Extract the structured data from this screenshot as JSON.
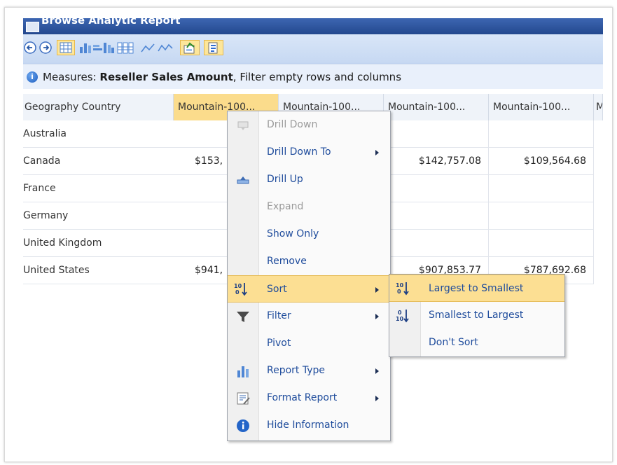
{
  "window": {
    "title": "Browse Analytic Report"
  },
  "toolbar": {
    "buttons": [
      {
        "name": "back-icon"
      },
      {
        "name": "forward-icon"
      },
      {
        "name": "grid-view-icon"
      },
      {
        "name": "bar-chart-icon"
      },
      {
        "name": "stacked-bar-icon"
      },
      {
        "name": "line-chart-icon"
      },
      {
        "name": "export-icon"
      },
      {
        "name": "info-toggle-icon"
      }
    ]
  },
  "info": {
    "prefix": "Measures:",
    "measure": "Reseller Sales Amount",
    "suffix": ", Filter empty rows and columns"
  },
  "grid": {
    "row_header": "Geography Country",
    "columns": [
      "Mountain-100...",
      "Mountain-100...",
      "Mountain-100...",
      "Mountain-100...",
      "M"
    ],
    "rows": [
      {
        "label": "Australia",
        "values": [
          "",
          "",
          "",
          ""
        ]
      },
      {
        "label": "Canada",
        "values": [
          "$153,",
          "",
          "$142,757.08",
          "$109,564.68"
        ]
      },
      {
        "label": "France",
        "values": [
          "",
          "",
          "",
          ""
        ]
      },
      {
        "label": "Germany",
        "values": [
          "",
          "",
          "",
          ""
        ]
      },
      {
        "label": "United Kingdom",
        "values": [
          "",
          "",
          "",
          ""
        ]
      },
      {
        "label": "United States",
        "values": [
          "$941,",
          "",
          "$907,853.77",
          "$787,692.68"
        ]
      }
    ]
  },
  "context_menu": {
    "items": [
      {
        "label": "Drill Down",
        "disabled": true,
        "icon": "drill-down-icon"
      },
      {
        "label": "Drill Down To",
        "submenu": true
      },
      {
        "label": "Drill Up",
        "icon": "drill-up-icon"
      },
      {
        "label": "Expand",
        "disabled": true
      },
      {
        "label": "Show Only"
      },
      {
        "label": "Remove"
      },
      {
        "label": "Sort",
        "submenu": true,
        "icon": "sort-icon",
        "highlighted": true
      },
      {
        "label": "Filter",
        "submenu": true,
        "icon": "filter-icon"
      },
      {
        "label": "Pivot"
      },
      {
        "label": "Report Type",
        "submenu": true,
        "icon": "report-type-icon"
      },
      {
        "label": "Format Report",
        "submenu": true,
        "icon": "format-report-icon"
      },
      {
        "label": "Hide Information",
        "icon": "info-icon"
      }
    ]
  },
  "sort_submenu": {
    "items": [
      {
        "label": "Largest to Smallest",
        "icon": "sort-descending-icon",
        "highlighted": true
      },
      {
        "label": "Smallest to Largest",
        "icon": "sort-ascending-icon"
      },
      {
        "label": "Don't Sort"
      }
    ]
  },
  "colors": {
    "highlight": "#fcdf93",
    "menu_text": "#1f4c9c",
    "title_bar": "#23488e"
  }
}
